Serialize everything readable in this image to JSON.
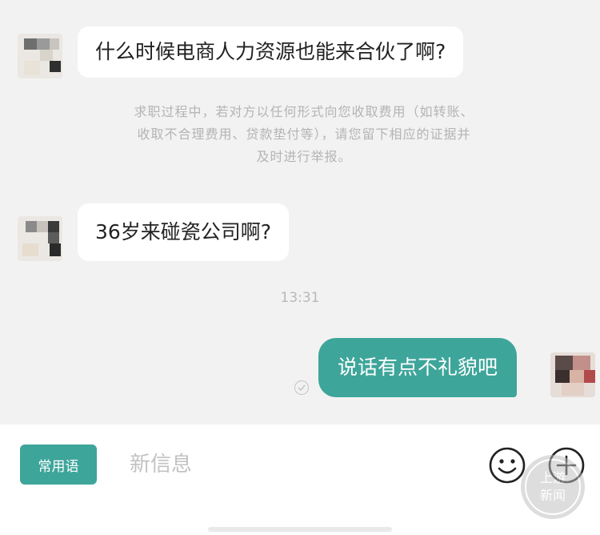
{
  "messages": {
    "m1": "什么时候电商人力资源也能来合伙了啊?",
    "m2": "36岁来碰瓷公司啊?",
    "m3": "说话有点不礼貌吧"
  },
  "notice": {
    "line1": "求职过程中，若对方以任何形式向您收取费用（如转账、",
    "line2": "收取不合理费用、贷款垫付等），请您留下相应的证据并",
    "line3": "及时进行举报。"
  },
  "timestamp": "13:31",
  "composer": {
    "quick_phrases_label": "常用语",
    "input_placeholder": "新信息"
  },
  "watermark": {
    "line1": "上游",
    "line2": "新闻"
  },
  "colors": {
    "accent": "#3ea59a",
    "background": "#f2f2f2",
    "bubble": "#ffffff"
  },
  "icons": [
    "emoji-icon",
    "plus-icon",
    "read-check-icon",
    "watermark-logo-icon"
  ]
}
